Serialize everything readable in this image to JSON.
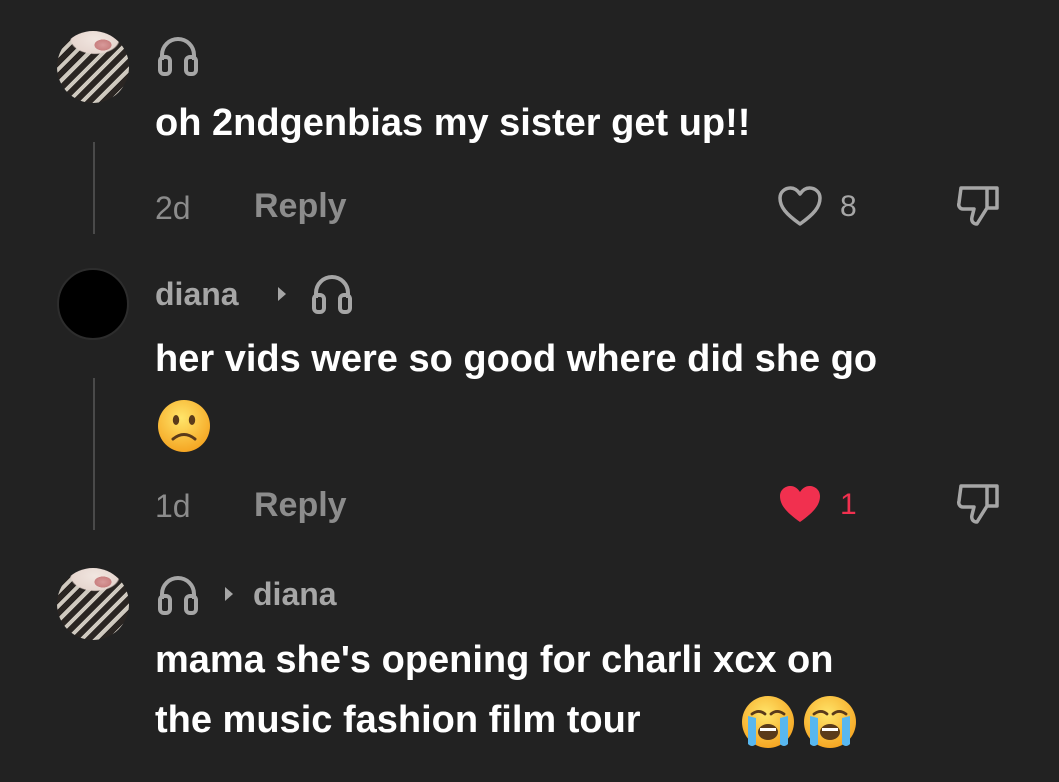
{
  "colors": {
    "background": "#222222",
    "text": "#ffffff",
    "muted": "#8c8c8c",
    "like_active": "#f1304f"
  },
  "comments": [
    {
      "author_icon": "headphones-icon",
      "text": "oh 2ndgenbias my sister get up!!",
      "time": "2d",
      "reply_label": "Reply",
      "likes": "8",
      "liked": false
    },
    {
      "author": "diana",
      "reply_to_icon": "headphones-icon",
      "text_line1": "her vids were so good where did she go",
      "emoji": "slightly-frowning-face",
      "time": "1d",
      "reply_label": "Reply",
      "likes": "1",
      "liked": true
    },
    {
      "author_icon": "headphones-icon",
      "reply_to": "diana",
      "text_line1": "mama she's opening for charli xcx on",
      "text_line2": "the music fashion film tour",
      "emoji": [
        "loudly-crying-face",
        "loudly-crying-face"
      ]
    }
  ]
}
